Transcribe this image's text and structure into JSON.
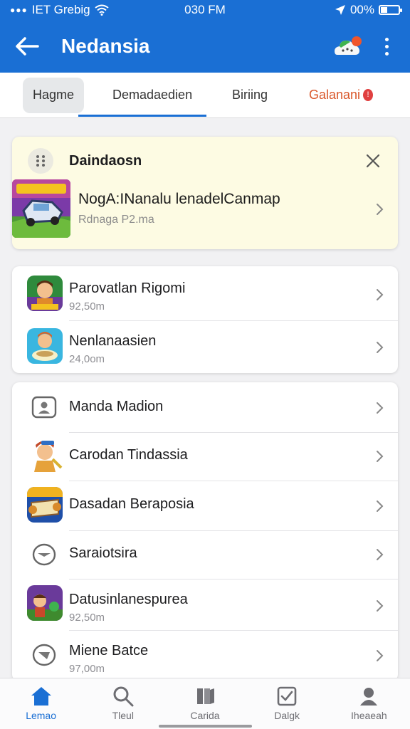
{
  "status_bar": {
    "carrier": "IET Grebig",
    "time": "030 FM",
    "battery_text": "00%"
  },
  "app_bar": {
    "title": "Nedansia",
    "back_icon": "arrow-left-icon",
    "cloud_icon": "cloud-badge-icon",
    "more_icon": "more-vertical-icon"
  },
  "tabs": [
    {
      "label": "Hagme",
      "selected": false
    },
    {
      "label": "Demadaedien",
      "selected": true
    },
    {
      "label": "Biriing",
      "selected": false
    },
    {
      "label": "Galanani",
      "selected": false,
      "color": "#d9572a"
    }
  ],
  "featured": {
    "heading": "Daindaosn",
    "title": "NogA:INanalu lenadelCanmap",
    "subtitle": "Rdnaga P2.ma"
  },
  "list_1": [
    {
      "label": "Parovatlan Rigomi",
      "sub": "92,50m"
    },
    {
      "label": "Nenlanaasien",
      "sub": "24,0om"
    }
  ],
  "list_2": [
    {
      "label": "Manda Madion",
      "sub": "",
      "icon": "user-card-icon"
    },
    {
      "label": "Carodan Tindassia",
      "sub": "",
      "icon": "character-icon"
    },
    {
      "label": "Dasadan Beraposia",
      "sub": "",
      "icon": "scroll-game-icon"
    },
    {
      "label": "Saraiotsira",
      "sub": "",
      "icon": "speech-bubble-icon"
    },
    {
      "label": "Datusinlanespurea",
      "sub": "92,50m",
      "icon": "adventure-game-icon"
    },
    {
      "label": "Miene Batce",
      "sub": "97,00m",
      "icon": "speech-bubble-icon"
    }
  ],
  "bottom_nav": [
    {
      "label": "Lemao",
      "icon": "home-icon",
      "active": true
    },
    {
      "label": "Tleul",
      "icon": "search-icon",
      "active": false
    },
    {
      "label": "Carida",
      "icon": "library-icon",
      "active": false
    },
    {
      "label": "Dalgk",
      "icon": "checkbox-icon",
      "active": false
    },
    {
      "label": "Iheaeah",
      "icon": "profile-icon",
      "active": false
    }
  ],
  "colors": {
    "brand": "#1a6fd4",
    "featured_bg": "#fdfbe3"
  }
}
